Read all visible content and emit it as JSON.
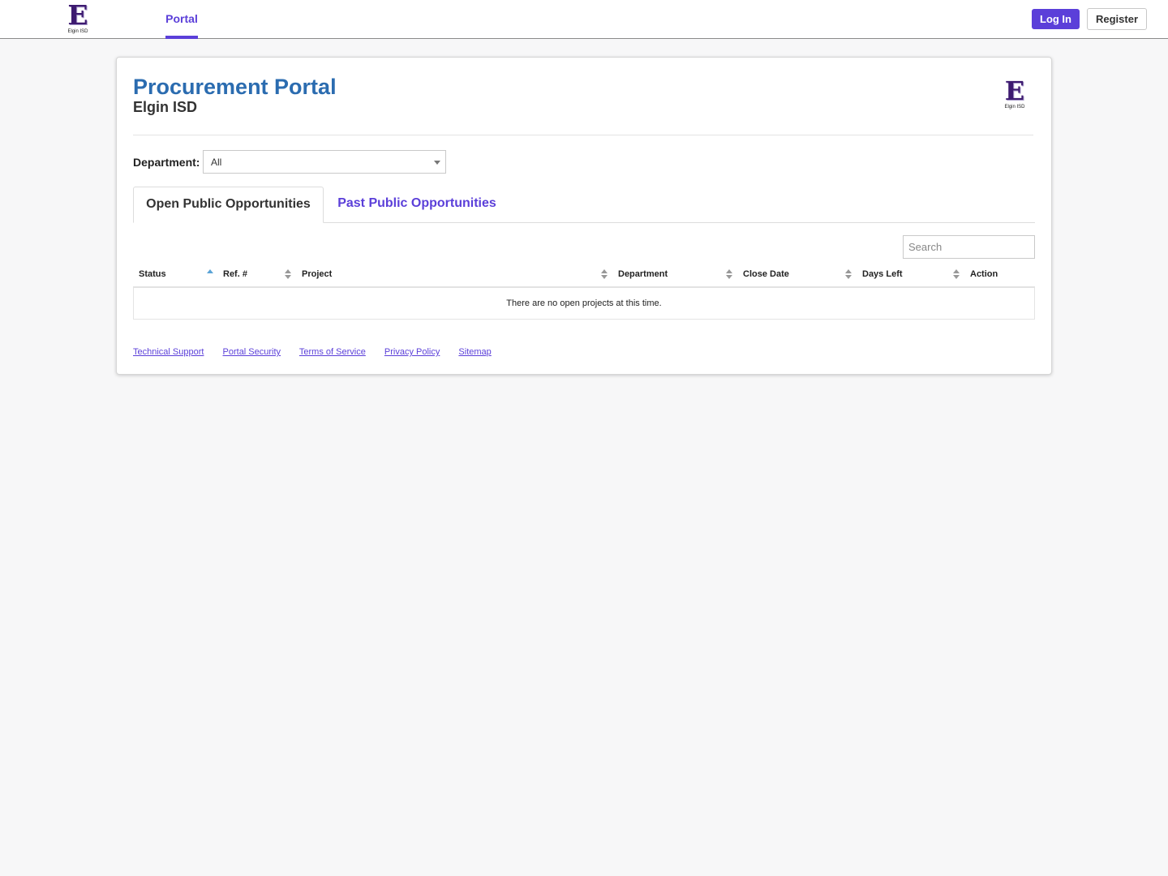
{
  "nav": {
    "logo_letter": "E",
    "logo_text": "Elgin ISD",
    "portal_tab": "Portal",
    "login_label": "Log In",
    "register_label": "Register",
    "accent_color": "#5b3fd9"
  },
  "header": {
    "title": "Procurement Portal",
    "subtitle": "Elgin ISD",
    "title_color": "#2b6cb0"
  },
  "filter": {
    "department_label": "Department:",
    "department_value": "All"
  },
  "tabs": [
    {
      "label": "Open Public Opportunities",
      "active": true
    },
    {
      "label": "Past Public Opportunities",
      "active": false
    }
  ],
  "search": {
    "placeholder": "Search",
    "value": ""
  },
  "table": {
    "columns": [
      "Status",
      "Ref. #",
      "Project",
      "Department",
      "Close Date",
      "Days Left",
      "Action"
    ],
    "sorted_column": "Status",
    "sort_direction": "ascending",
    "empty_message": "There are no open projects at this time.",
    "rows": []
  },
  "footer": {
    "links": [
      "Technical Support",
      "Portal Security",
      "Terms of Service",
      "Privacy Policy",
      "Sitemap"
    ]
  }
}
